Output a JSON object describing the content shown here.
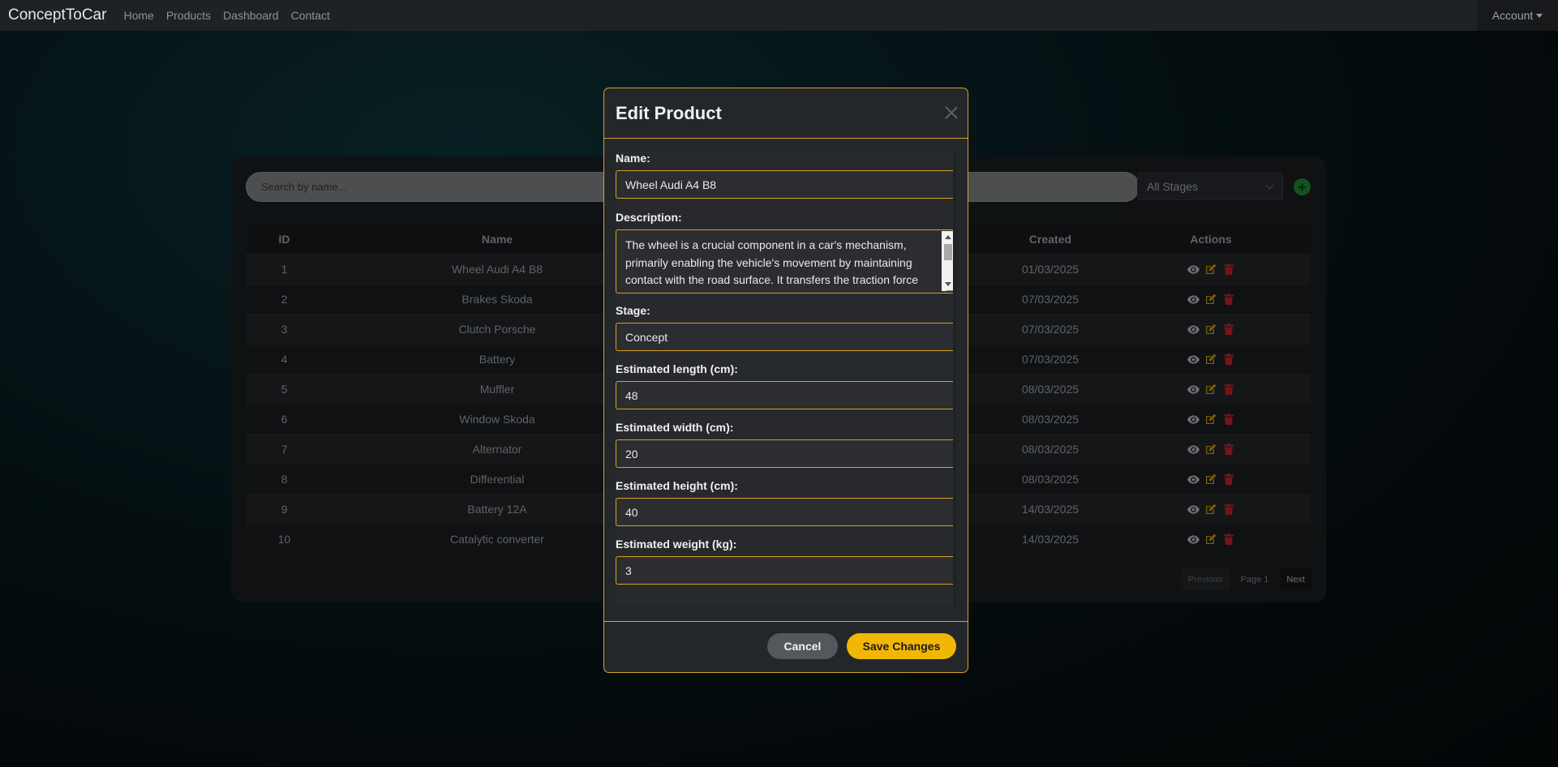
{
  "navbar": {
    "brand": "ConceptToCar",
    "links": [
      "Home",
      "Products",
      "Dashboard",
      "Contact"
    ],
    "account": "Account"
  },
  "toolbar": {
    "search_placeholder": "Search by name...",
    "stage_filter": "All Stages"
  },
  "table": {
    "headers": {
      "id": "ID",
      "name": "Name",
      "created": "Created",
      "actions": "Actions"
    },
    "rows": [
      {
        "id": "1",
        "name": "Wheel Audi A4 B8",
        "created": "01/03/2025"
      },
      {
        "id": "2",
        "name": "Brakes Skoda",
        "created": "07/03/2025"
      },
      {
        "id": "3",
        "name": "Clutch Porsche",
        "created": "07/03/2025"
      },
      {
        "id": "4",
        "name": "Battery",
        "created": "07/03/2025"
      },
      {
        "id": "5",
        "name": "Muffler",
        "created": "08/03/2025"
      },
      {
        "id": "6",
        "name": "Window Skoda",
        "created": "08/03/2025"
      },
      {
        "id": "7",
        "name": "Alternator",
        "created": "08/03/2025"
      },
      {
        "id": "8",
        "name": "Differential",
        "created": "08/03/2025"
      },
      {
        "id": "9",
        "name": "Battery 12A",
        "created": "14/03/2025"
      },
      {
        "id": "10",
        "name": "Catalytic converter",
        "created": "14/03/2025"
      }
    ]
  },
  "pager": {
    "previous": "Previous",
    "page": "Page 1",
    "next": "Next"
  },
  "modal": {
    "title": "Edit Product",
    "fields": {
      "name_label": "Name:",
      "name_value": "Wheel Audi A4 B8",
      "description_label": "Description:",
      "description_value": "The wheel is a crucial component in a car's mechanism, primarily enabling the vehicle's movement by maintaining contact with the road surface. It transfers the traction force",
      "stage_label": "Stage:",
      "stage_value": "Concept",
      "length_label": "Estimated length (cm):",
      "length_value": "48",
      "width_label": "Estimated width (cm):",
      "width_value": "20",
      "height_label": "Estimated height (cm):",
      "height_value": "40",
      "weight_label": "Estimated weight (kg):",
      "weight_value": "3"
    },
    "cancel": "Cancel",
    "save": "Save Changes"
  },
  "colors": {
    "accent": "#f2b705",
    "border_accent": "#d8a320",
    "view_icon": "#c8cdd2",
    "edit_icon": "#e3a80e",
    "delete_icon": "#d6262f",
    "add_button": "#1f9a3e"
  }
}
